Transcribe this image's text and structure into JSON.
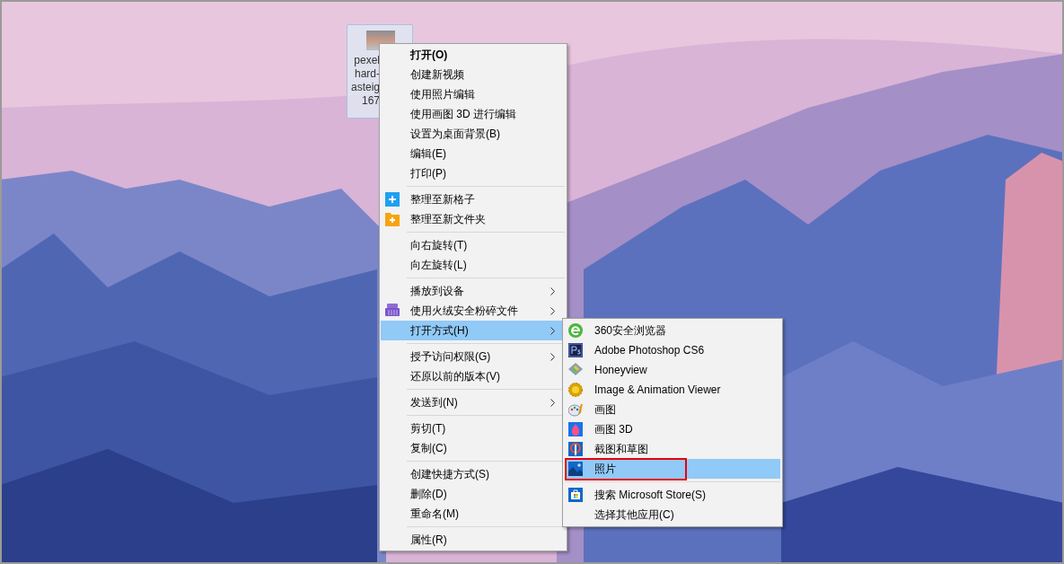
{
  "desktop_icon": {
    "label_lines": [
      "pexel",
      "hard-",
      "asteig",
      "167"
    ],
    "selected": true
  },
  "context_menu": {
    "groups": [
      [
        {
          "label": "打开(O)",
          "default": true,
          "submenu": false,
          "selected": false
        },
        {
          "label": "创建新视频",
          "default": false,
          "submenu": false,
          "selected": false
        },
        {
          "label": "使用照片编辑",
          "default": false,
          "submenu": false,
          "selected": false
        },
        {
          "label": "使用画图 3D 进行编辑",
          "default": false,
          "submenu": false,
          "selected": false
        },
        {
          "label": "设置为桌面背景(B)",
          "default": false,
          "submenu": false,
          "selected": false
        },
        {
          "label": "编辑(E)",
          "default": false,
          "submenu": false,
          "selected": false
        },
        {
          "label": "打印(P)",
          "default": false,
          "submenu": false,
          "selected": false
        }
      ],
      [
        {
          "label": "整理至新格子",
          "default": false,
          "submenu": false,
          "selected": false
        },
        {
          "label": "整理至新文件夹",
          "default": false,
          "submenu": false,
          "selected": false
        }
      ],
      [
        {
          "label": "向右旋转(T)",
          "default": false,
          "submenu": false,
          "selected": false
        },
        {
          "label": "向左旋转(L)",
          "default": false,
          "submenu": false,
          "selected": false
        }
      ],
      [
        {
          "label": "播放到设备",
          "default": false,
          "submenu": true,
          "selected": false
        },
        {
          "label": "使用火绒安全粉碎文件",
          "default": false,
          "submenu": true,
          "selected": false
        },
        {
          "label": "打开方式(H)",
          "default": false,
          "submenu": true,
          "selected": true
        }
      ],
      [
        {
          "label": "授予访问权限(G)",
          "default": false,
          "submenu": true,
          "selected": false
        },
        {
          "label": "还原以前的版本(V)",
          "default": false,
          "submenu": false,
          "selected": false
        }
      ],
      [
        {
          "label": "发送到(N)",
          "default": false,
          "submenu": true,
          "selected": false
        }
      ],
      [
        {
          "label": "剪切(T)",
          "default": false,
          "submenu": false,
          "selected": false
        },
        {
          "label": "复制(C)",
          "default": false,
          "submenu": false,
          "selected": false
        }
      ],
      [
        {
          "label": "创建快捷方式(S)",
          "default": false,
          "submenu": false,
          "selected": false
        },
        {
          "label": "删除(D)",
          "default": false,
          "submenu": false,
          "selected": false
        },
        {
          "label": "重命名(M)",
          "default": false,
          "submenu": false,
          "selected": false
        }
      ],
      [
        {
          "label": "属性(R)",
          "default": false,
          "submenu": false,
          "selected": false
        }
      ]
    ]
  },
  "open_with_menu": {
    "groups": [
      [
        {
          "label": "360安全浏览器",
          "selected": false,
          "outlined": false
        },
        {
          "label": "Adobe Photoshop CS6",
          "selected": false,
          "outlined": false
        },
        {
          "label": "Honeyview",
          "selected": false,
          "outlined": false
        },
        {
          "label": "Image & Animation Viewer",
          "selected": false,
          "outlined": false
        },
        {
          "label": "画图",
          "selected": false,
          "outlined": false
        },
        {
          "label": "画图 3D",
          "selected": false,
          "outlined": false
        },
        {
          "label": "截图和草图",
          "selected": false,
          "outlined": false
        },
        {
          "label": "照片",
          "selected": true,
          "outlined": true
        }
      ],
      [
        {
          "label": "搜索 Microsoft Store(S)",
          "selected": false,
          "outlined": false
        },
        {
          "label": "选择其他应用(C)",
          "selected": false,
          "outlined": false
        }
      ]
    ]
  }
}
